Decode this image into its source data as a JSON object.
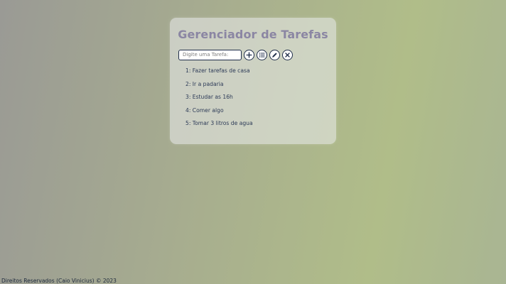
{
  "app": {
    "title": "Gerenciador de Tarefas"
  },
  "form": {
    "input_placeholder": "Digite uma Tarefa:",
    "input_value": "",
    "buttons": [
      {
        "icon": "plus-icon"
      },
      {
        "icon": "list-icon"
      },
      {
        "icon": "pencil-icon"
      },
      {
        "icon": "close-icon"
      }
    ]
  },
  "tasks": [
    {
      "label": "1: Fazer tarefas de casa"
    },
    {
      "label": "2: Ir a padaria"
    },
    {
      "label": "3: Estudar as 16h"
    },
    {
      "label": "4: Comer algo"
    },
    {
      "label": "5: Tomar 3 litros de agua"
    }
  ],
  "footer": {
    "text": "Direitos Reservados (Caio Vinicius) © 2023"
  },
  "colors": {
    "title": "#8b86a3",
    "text": "#2c3a57",
    "button_border": "#1f2d4a"
  }
}
